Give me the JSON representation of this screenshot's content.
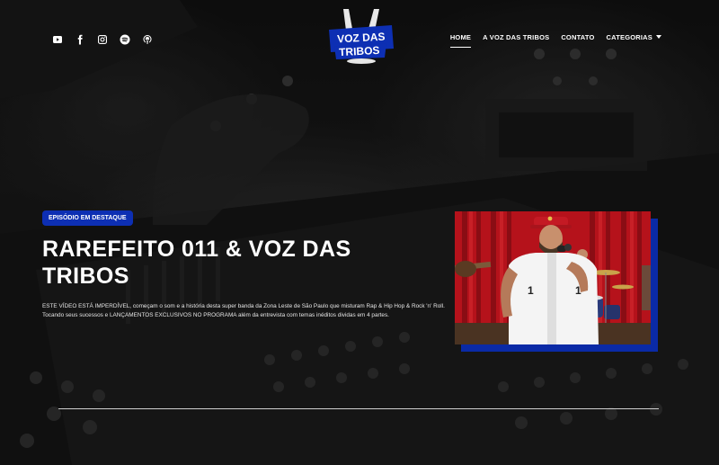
{
  "brand": {
    "logo_line1": "VOZ DAS",
    "logo_line2": "TRIBOS",
    "accent": "#0d2fb3"
  },
  "social": [
    {
      "icon": "youtube-icon"
    },
    {
      "icon": "facebook-icon"
    },
    {
      "icon": "instagram-icon"
    },
    {
      "icon": "spotify-icon"
    },
    {
      "icon": "podcast-icon"
    }
  ],
  "nav": {
    "items": [
      {
        "label": "HOME",
        "active": true
      },
      {
        "label": "A VOZ DAS TRIBOS"
      },
      {
        "label": "CONTATO"
      },
      {
        "label": "CATEGORIAS",
        "has_dropdown": true
      }
    ]
  },
  "featured": {
    "badge": "EPISÓDIO EM DESTAQUE",
    "title": "RAREFEITO 011 & VOZ DAS TRIBOS",
    "description": "ESTE VÍDEO ESTÁ IMPERDÍVEL, começam o som e a história desta super banda da Zona Leste de São Paulo que misturam Rap & Hip Hop & Rock 'n' Roll. Tocando seus sucessos e LANÇAMENTOS EXCLUSIVOS NO PROGRAMA além da entrevista com temas inéditos dividas em 4 partes."
  }
}
